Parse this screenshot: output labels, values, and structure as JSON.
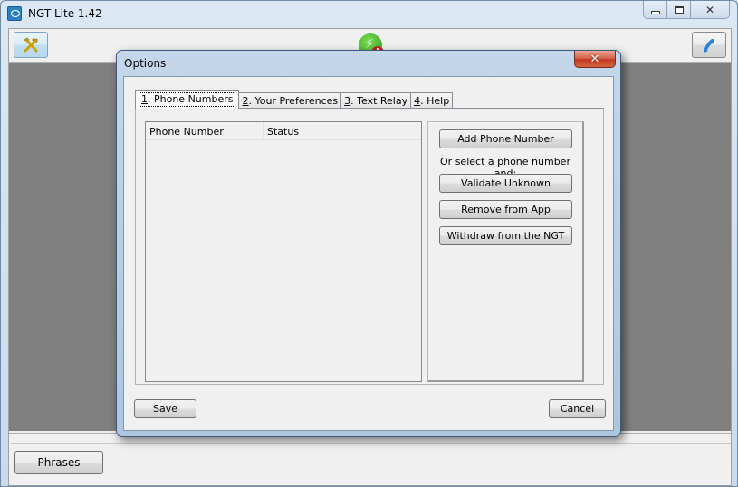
{
  "app": {
    "title": "NGT Lite 1.42",
    "window_controls": {
      "minimize_icon": "minimize-icon",
      "maximize_icon": "maximize-icon",
      "close_icon": "close-icon",
      "close_glyph": "✕"
    }
  },
  "toolbar": {
    "settings_icon": "tools-icon",
    "status_icon": "ngt-status-icon",
    "status_bolt": "⚡",
    "status_alert": "!",
    "phone_icon": "phone-icon"
  },
  "bottom_bar": {
    "phrases_label": "Phrases"
  },
  "dialog": {
    "title": "Options",
    "close_glyph": "✕",
    "tabs": [
      {
        "mnemonic": "1",
        "label": ". Phone Numbers",
        "active": true
      },
      {
        "mnemonic": "2",
        "label": ". Your Preferences",
        "active": false
      },
      {
        "mnemonic": "3",
        "label": ". Text Relay",
        "active": false
      },
      {
        "mnemonic": "4",
        "label": ". Help",
        "active": false
      }
    ],
    "list": {
      "columns": [
        "Phone Number",
        "Status"
      ],
      "rows": []
    },
    "actions": {
      "add_label": "Add Phone Number",
      "select_prompt": "Or select a phone number and:",
      "validate_label": "Validate Unknown",
      "remove_label": "Remove from App",
      "withdraw_label": "Withdraw from the NGT"
    },
    "save_label": "Save",
    "cancel_label": "Cancel"
  }
}
